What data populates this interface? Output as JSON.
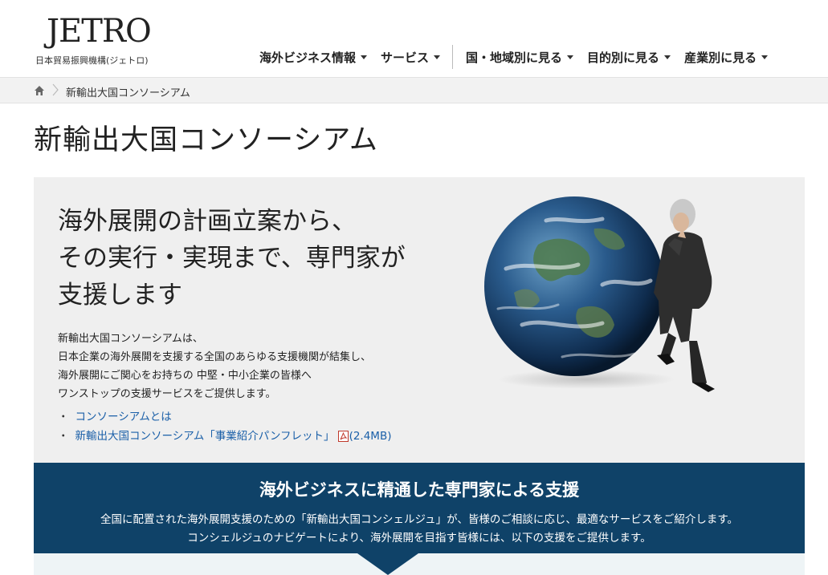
{
  "header": {
    "logo_mark": "JETRO",
    "logo_sub": "日本貿易振興機構(ジェトロ)",
    "nav": [
      {
        "label": "海外ビジネス情報",
        "icon": "chevron-down-icon"
      },
      {
        "label": "サービス",
        "icon": "chevron-down-icon"
      },
      {
        "label": "国・地域別に見る",
        "icon": "chevron-down-icon"
      },
      {
        "label": "目的別に見る",
        "icon": "chevron-down-icon"
      },
      {
        "label": "産業別に見る",
        "icon": "chevron-down-icon"
      }
    ]
  },
  "breadcrumb": {
    "home_icon": "home-icon",
    "current": "新輸出大国コンソーシアム"
  },
  "page": {
    "title": "新輸出大国コンソーシアム"
  },
  "hero": {
    "heading_lines": [
      "海外展開の計画立案から、",
      "その実行・実現まで、専門家が",
      "支援します"
    ],
    "body_lines": [
      "新輸出大国コンソーシアムは、",
      "日本企業の海外展開を支援する全国のあらゆる支援機関が結集し、",
      "海外展開にご関心をお持ちの 中堅・中小企業の皆様へ",
      "ワンストップの支援サービスをご提供します。"
    ],
    "links": [
      {
        "bullet": "・",
        "label": "コンソーシアムとは"
      },
      {
        "bullet": "・",
        "label": "新輸出大国コンソーシアム「事業紹介パンフレット」",
        "icon": "pdf-icon",
        "size": "(2.4MB)"
      }
    ]
  },
  "band": {
    "title": "海外ビジネスに精通した専門家による支援",
    "lines": [
      "全国に配置された海外展開支援のための「新輸出大国コンシェルジュ」が、皆様のご相談に応じ、最適なサービスをご紹介します。",
      "コンシェルジュのナビゲートにより、海外展開を目指す皆様には、以下の支援をご提供します。"
    ]
  },
  "colors": {
    "band_bg": "#0f4268",
    "hero_bg": "#efefef",
    "link": "#1a5fa8",
    "breadcrumb_bg": "#f2f2f2"
  }
}
